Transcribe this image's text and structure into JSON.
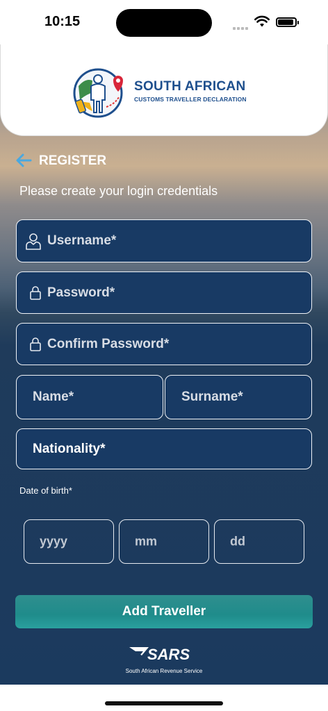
{
  "status_bar": {
    "time": "10:15"
  },
  "header": {
    "logo_title": "SOUTH AFRICAN",
    "logo_subtitle": "CUSTOMS TRAVELLER DECLARATION"
  },
  "nav": {
    "back_icon": "arrow-left-icon",
    "title": "REGISTER"
  },
  "form": {
    "instruction": "Please create your login credentials",
    "username_placeholder": "Username*",
    "password_placeholder": "Password*",
    "confirm_password_placeholder": "Confirm Password*",
    "name_placeholder": "Name*",
    "surname_placeholder": "Surname*",
    "nationality_placeholder": "Nationality*",
    "dob_label": "Date of birth*",
    "dob_year_placeholder": "yyyy",
    "dob_month_placeholder": "mm",
    "dob_day_placeholder": "dd",
    "submit_label": "Add Traveller"
  },
  "footer": {
    "org_name": "South African Revenue Service"
  },
  "colors": {
    "field_bg": "#183a64",
    "accent_teal": "#1f8c8b",
    "brand_blue": "#1e4f8d",
    "back_arrow": "#4aa8e0"
  }
}
